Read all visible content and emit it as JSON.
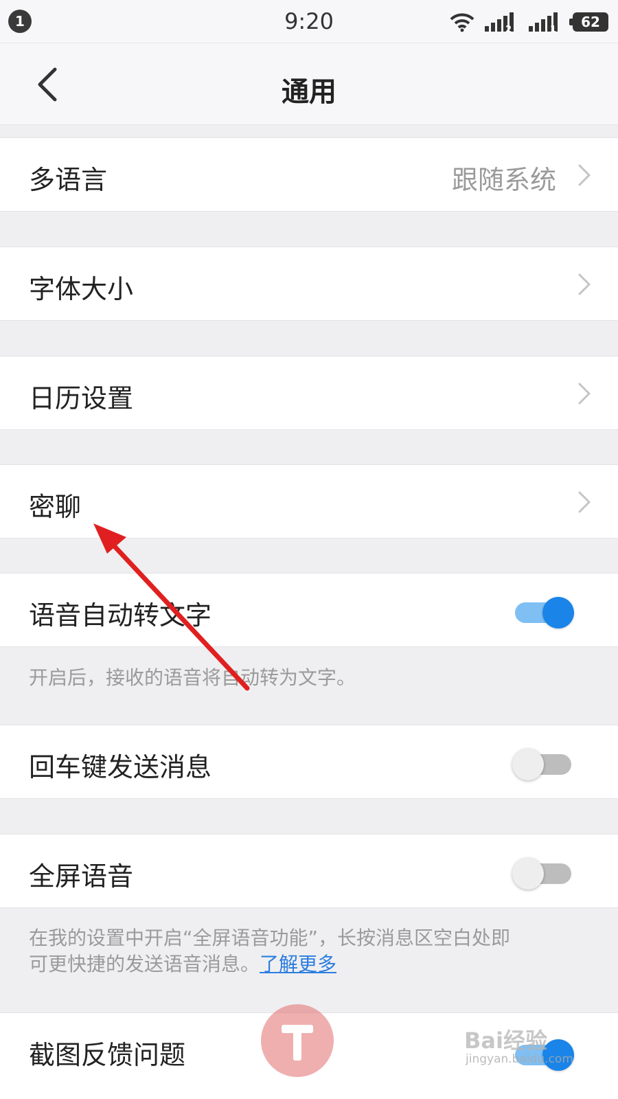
{
  "status_bar": {
    "notification_count": "1",
    "time": "9:20",
    "sim1": "2",
    "sim2": "1",
    "battery": "62"
  },
  "header": {
    "title": "通用",
    "back_icon": "chevron-left-icon"
  },
  "settings": {
    "language": {
      "label": "多语言",
      "value": "跟随系统"
    },
    "font_size": {
      "label": "字体大小"
    },
    "calendar": {
      "label": "日历设置"
    },
    "secret_chat": {
      "label": "密聊"
    },
    "voice_to_text": {
      "label": "语音自动转文字",
      "enabled": true,
      "hint": "开启后，接收的语音将自动转为文字。"
    },
    "enter_to_send": {
      "label": "回车键发送消息",
      "enabled": false
    },
    "fullscreen_voice": {
      "label": "全屏语音",
      "enabled": false,
      "hint_line1": "在我的设置中开启“全屏语音功能”，长按消息区空白处即",
      "hint_line2": "可更快捷的发送语音消息。",
      "hint_link": "了解更多"
    },
    "screenshot_feedback": {
      "label": "截图反馈问题"
    }
  },
  "watermark": {
    "brand": "Bai经验",
    "url": "jingyan.baidu.com"
  },
  "colors": {
    "accent": "#1a84e8",
    "annotation_arrow": "#e02020",
    "link": "#2b7de0"
  }
}
